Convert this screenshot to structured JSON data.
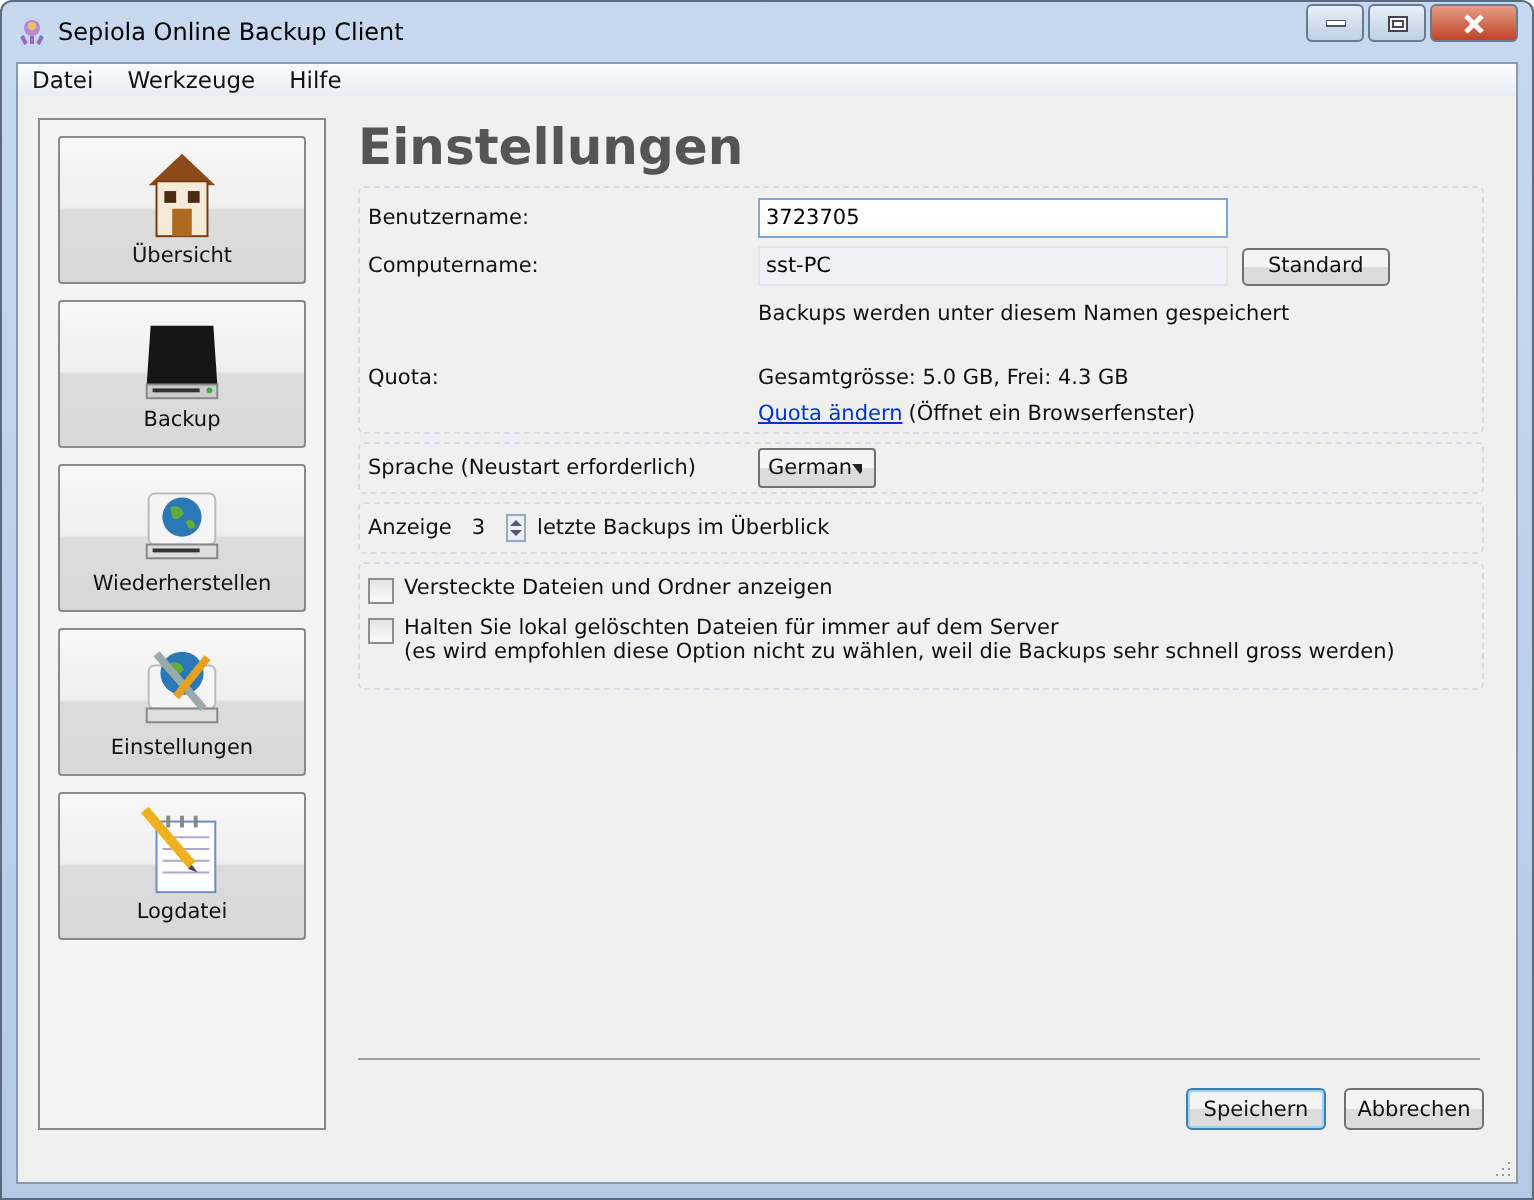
{
  "window": {
    "title": "Sepiola Online Backup Client"
  },
  "menu": [
    "Datei",
    "Werkzeuge",
    "Hilfe"
  ],
  "sidebar": {
    "items": [
      {
        "label": "Übersicht",
        "kind": "house"
      },
      {
        "label": "Backup",
        "kind": "drive"
      },
      {
        "label": "Wiederherstellen",
        "kind": "globe"
      },
      {
        "label": "Einstellungen",
        "kind": "tools"
      },
      {
        "label": "Logdatei",
        "kind": "notepad"
      }
    ]
  },
  "page_title": "Einstellungen",
  "account": {
    "username_label": "Benutzername:",
    "username": "3723705",
    "computer_label": "Computername:",
    "computer": "sst-PC",
    "standard_button": "Standard",
    "computer_hint": "Backups werden unter diesem Namen gespeichert",
    "quota_label": "Quota:",
    "quota": "Gesamtgrösse: 5.0 GB, Frei: 4.3 GB",
    "quota_link": "Quota ändern",
    "quota_note": "(Öffnet ein Browserfenster)"
  },
  "language": {
    "label": "Sprache (Neustart erforderlich)",
    "value": "German"
  },
  "display": {
    "before": "Anzeige",
    "count": "3",
    "after": "letzte Backups im Überblick"
  },
  "options": [
    {
      "label": "Versteckte Dateien und Ordner anzeigen",
      "checked": false
    },
    {
      "label": "Halten Sie lokal gelöschten Dateien für immer auf dem Server",
      "note": "(es wird empfohlen diese Option nicht zu wählen, weil die Backups sehr schnell gross werden)",
      "checked": false
    }
  ],
  "buttons": [
    "Speichern",
    "Abbrechen"
  ]
}
